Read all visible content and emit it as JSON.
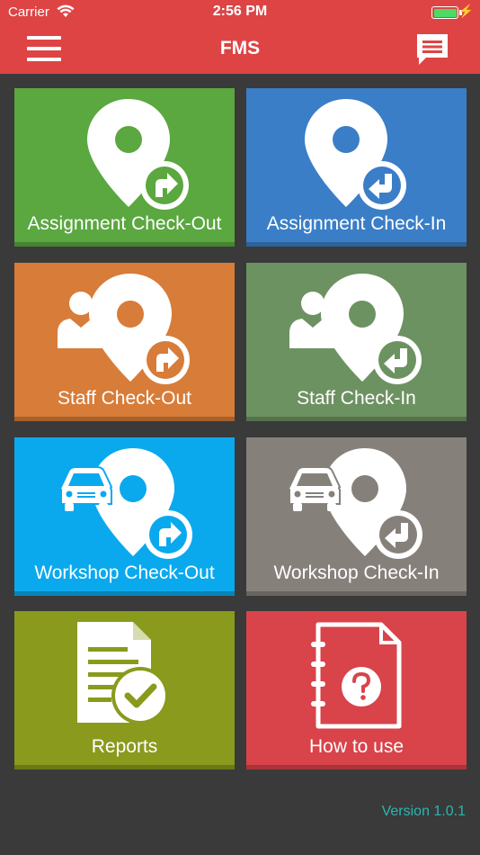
{
  "status_bar": {
    "carrier": "Carrier",
    "time": "2:56 PM"
  },
  "header": {
    "title": "FMS",
    "menu_icon": "hamburger-menu-icon",
    "message_icon": "chat-message-icon"
  },
  "tiles": [
    {
      "label": "Assignment Check-Out",
      "color": "#5aa83f",
      "icon": "location-pin-checkout-icon"
    },
    {
      "label": "Assignment Check-In",
      "color": "#3a7ec7",
      "icon": "location-pin-checkin-icon"
    },
    {
      "label": "Staff Check-Out",
      "color": "#d87c39",
      "icon": "staff-checkout-icon"
    },
    {
      "label": "Staff Check-In",
      "color": "#6d9261",
      "icon": "staff-checkin-icon"
    },
    {
      "label": "Workshop Check-Out",
      "color": "#0aa9ee",
      "icon": "car-checkout-icon"
    },
    {
      "label": "Workshop Check-In",
      "color": "#86807b",
      "icon": "car-checkin-icon"
    },
    {
      "label": "Reports",
      "color": "#8a9a1c",
      "icon": "report-document-icon"
    },
    {
      "label": "How to use",
      "color": "#d9434a",
      "icon": "help-notebook-icon"
    }
  ],
  "footer": {
    "version": "Version 1.0.1",
    "version_color": "#29b6b0"
  }
}
